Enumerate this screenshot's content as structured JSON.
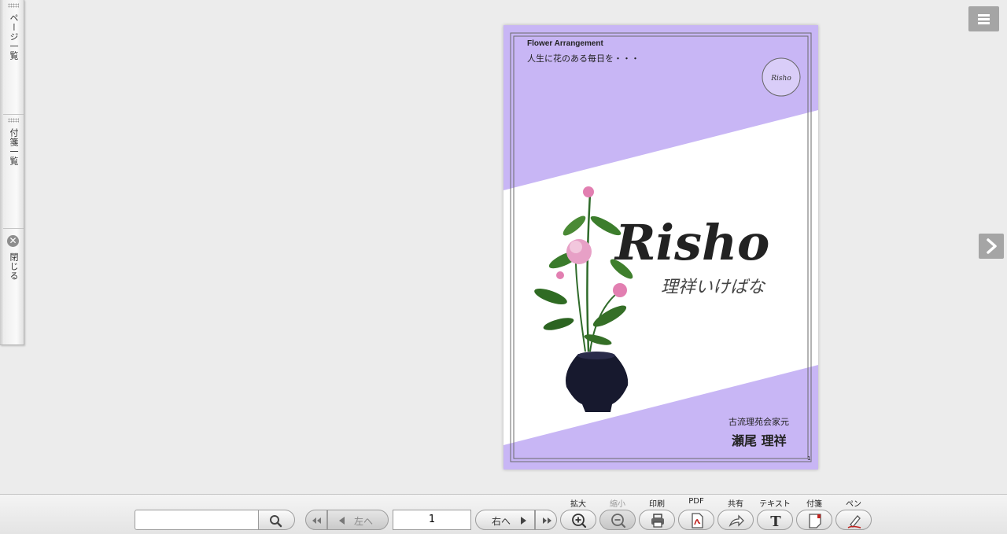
{
  "sidebar": {
    "tabs": [
      {
        "label": "ページ一覧"
      },
      {
        "label": "付箋一覧"
      }
    ],
    "close_label": "閉じる"
  },
  "cover": {
    "subtitle_en": "Flower Arrangement",
    "tagline": "人生に花のある毎日を・・・",
    "logo_text": "Risho",
    "logo_subtext": "理祥いけばな",
    "seal_text": "Risho",
    "school": "古流理苑会家元",
    "author": "瀬尾 理祥",
    "page_number": "1",
    "colors": {
      "lavender": "#c8b6f5",
      "white": "#ffffff",
      "frame": "#6a6a6a"
    }
  },
  "toolbar": {
    "search": {
      "placeholder": "",
      "value": ""
    },
    "first_icon": "double-left-arrow-icon",
    "prev_label": "左へ",
    "page_value": "1",
    "next_label": "右へ",
    "last_icon": "double-right-arrow-icon",
    "tools": [
      {
        "label": "拡大",
        "icon": "zoom-in-icon",
        "enabled": true
      },
      {
        "label": "縮小",
        "icon": "zoom-out-icon",
        "enabled": false
      },
      {
        "label": "印刷",
        "icon": "print-icon",
        "enabled": true
      },
      {
        "label": "PDF",
        "icon": "pdf-icon",
        "enabled": true
      },
      {
        "label": "共有",
        "icon": "share-icon",
        "enabled": true
      },
      {
        "label": "テキスト",
        "icon": "text-icon",
        "enabled": true
      },
      {
        "label": "付箋",
        "icon": "sticky-note-icon",
        "enabled": true
      },
      {
        "label": "ペン",
        "icon": "pen-icon",
        "enabled": true
      }
    ]
  }
}
